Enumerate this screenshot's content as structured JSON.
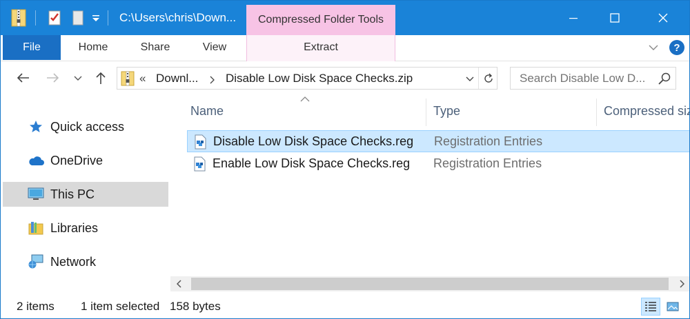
{
  "titlebar": {
    "path_title": "C:\\Users\\chris\\Down...",
    "context_tab": "Compressed Folder Tools",
    "minimize_label": "Minimize",
    "maximize_label": "Maximize",
    "close_label": "Close"
  },
  "ribbon": {
    "file": "File",
    "tabs": [
      "Home",
      "Share",
      "View"
    ],
    "context_tab": "Extract",
    "help": "?"
  },
  "address": {
    "overflow": "«",
    "crumbs": [
      "Downl...",
      "Disable Low Disk Space Checks.zip"
    ],
    "search_placeholder": "Search Disable Low D..."
  },
  "navpane": {
    "items": [
      {
        "label": "Quick access",
        "icon": "star-icon"
      },
      {
        "label": "OneDrive",
        "icon": "cloud-icon"
      },
      {
        "label": "This PC",
        "icon": "computer-icon",
        "selected": true
      },
      {
        "label": "Libraries",
        "icon": "libraries-icon"
      },
      {
        "label": "Network",
        "icon": "network-icon"
      }
    ]
  },
  "filelist": {
    "columns": [
      "Name",
      "Type",
      "Compressed size"
    ],
    "rows": [
      {
        "name": "Disable Low Disk Space Checks.reg",
        "type": "Registration Entries",
        "selected": true
      },
      {
        "name": "Enable Low Disk Space Checks.reg",
        "type": "Registration Entries",
        "selected": false
      }
    ]
  },
  "status": {
    "item_count": "2 items",
    "selection": "1 item selected",
    "size": "158 bytes"
  },
  "colors": {
    "titlebar": "#1a83d8",
    "file_tab": "#1a6fc4",
    "context_tab": "#f7c3e5",
    "selection": "#cce8ff"
  }
}
